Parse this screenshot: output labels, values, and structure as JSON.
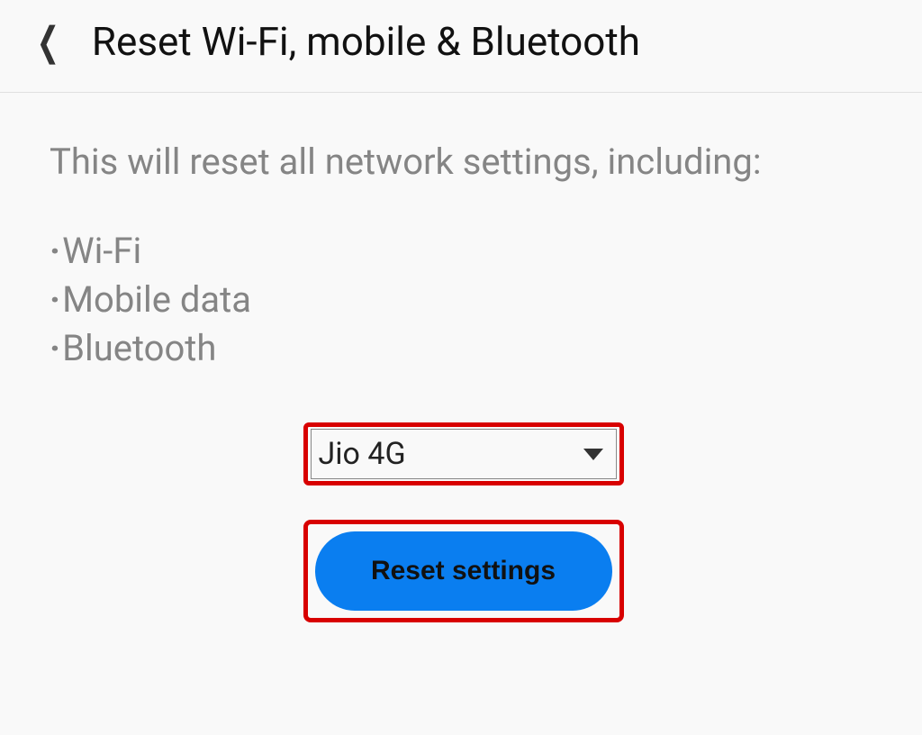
{
  "header": {
    "title": "Reset Wi-Fi, mobile & Bluetooth"
  },
  "main": {
    "description": "This will reset all network settings, including:",
    "bullets": [
      "Wi-Fi",
      "Mobile data",
      "Bluetooth"
    ],
    "dropdown": {
      "selected": "Jio 4G"
    },
    "button_label": "Reset settings"
  },
  "colors": {
    "accent": "#0a7ef0",
    "highlight": "#d80000"
  }
}
